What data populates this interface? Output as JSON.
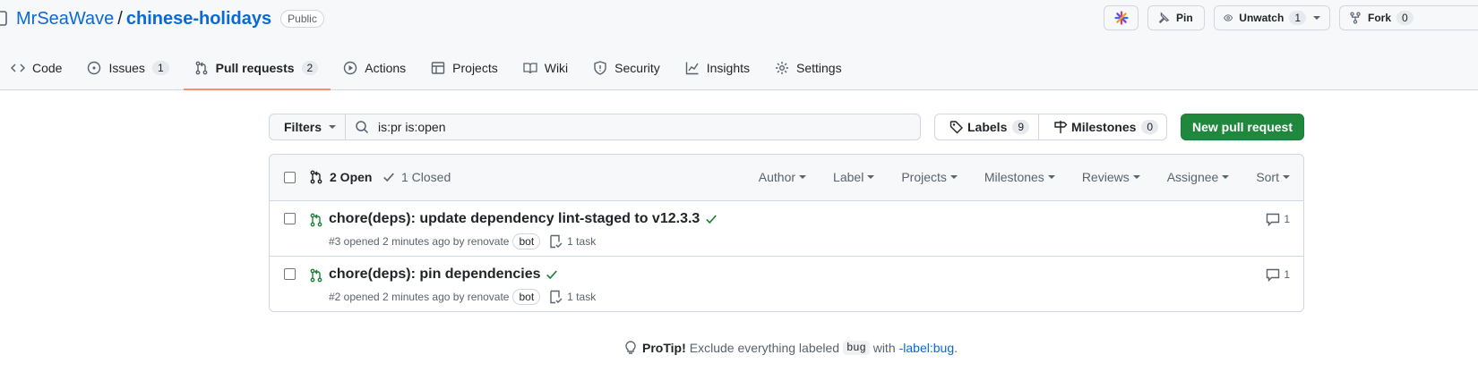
{
  "repo": {
    "owner": "MrSeaWave",
    "separator": "/",
    "name": "chinese-holidays",
    "visibility": "Public"
  },
  "actions": {
    "pin_label": "Pin",
    "unwatch_label": "Unwatch",
    "unwatch_count": "1",
    "fork_label": "Fork",
    "fork_count": "0"
  },
  "tabs": [
    {
      "label": "Code",
      "icon": "code-icon",
      "count": ""
    },
    {
      "label": "Issues",
      "icon": "issue-icon",
      "count": "1"
    },
    {
      "label": "Pull requests",
      "icon": "pull-request-icon",
      "count": "2",
      "active": true
    },
    {
      "label": "Actions",
      "icon": "play-icon",
      "count": ""
    },
    {
      "label": "Projects",
      "icon": "table-icon",
      "count": ""
    },
    {
      "label": "Wiki",
      "icon": "book-icon",
      "count": ""
    },
    {
      "label": "Security",
      "icon": "shield-icon",
      "count": ""
    },
    {
      "label": "Insights",
      "icon": "graph-icon",
      "count": ""
    },
    {
      "label": "Settings",
      "icon": "gear-icon",
      "count": ""
    }
  ],
  "toolbar": {
    "filters_label": "Filters",
    "search_value": "is:pr is:open",
    "labels_label": "Labels",
    "labels_count": "9",
    "milestones_label": "Milestones",
    "milestones_count": "0",
    "new_pr_label": "New pull request"
  },
  "list": {
    "open_label": "2 Open",
    "closed_label": "1 Closed",
    "filters": [
      "Author",
      "Label",
      "Projects",
      "Milestones",
      "Reviews",
      "Assignee",
      "Sort"
    ]
  },
  "pulls": [
    {
      "title": "chore(deps): update dependency lint-staged to v12.3.3",
      "meta": "#3 opened 2 minutes ago by renovate",
      "badge": "bot",
      "tasks": "1 task",
      "comments": "1",
      "status_color": "#1a7f37"
    },
    {
      "title": "chore(deps): pin dependencies",
      "meta": "#2 opened 2 minutes ago by renovate",
      "badge": "bot",
      "tasks": "1 task",
      "comments": "1",
      "status_color": "#1a7f37"
    }
  ],
  "protip": {
    "lead": "ProTip!",
    "text_before": "Exclude everything labeled",
    "code": "bug",
    "text_with": "with",
    "link": "-label:bug",
    "end": "."
  }
}
